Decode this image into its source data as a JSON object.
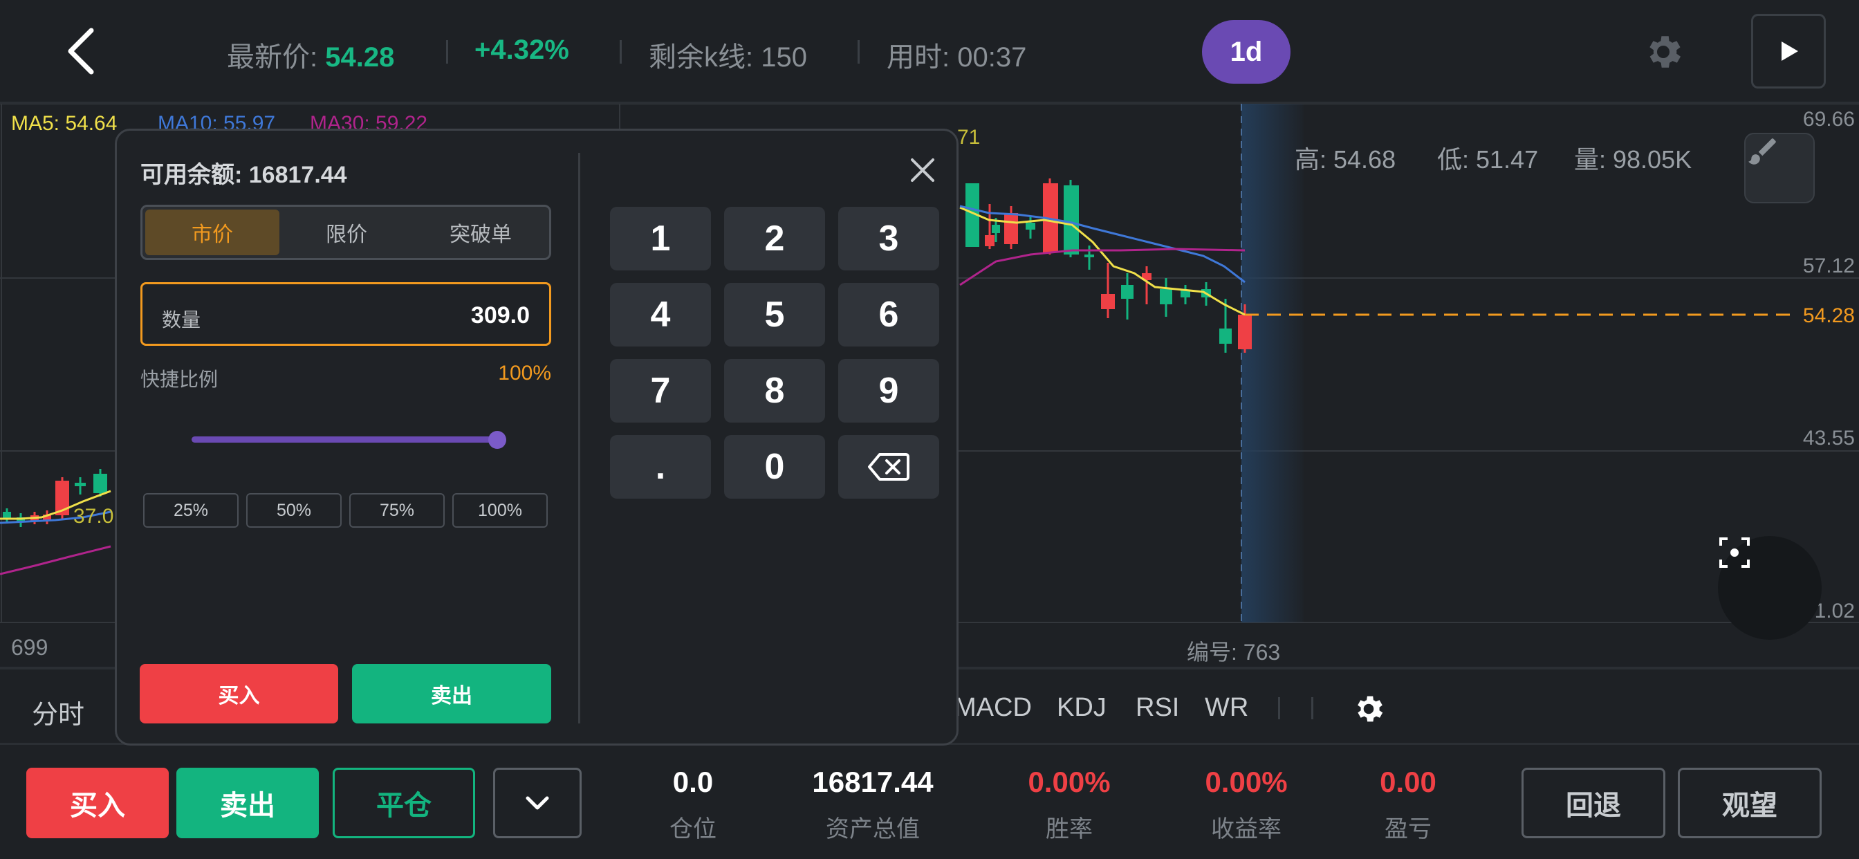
{
  "header": {
    "latest_label": "最新价:",
    "latest_price": "54.28",
    "change_pct": "+4.32%",
    "remaining_label": "剩余k线:",
    "remaining_value": "150",
    "time_label": "用时:",
    "time_value": "00:37",
    "timeframe": "1d",
    "icons": [
      "back-icon",
      "gear-icon",
      "play-icon"
    ]
  },
  "chart": {
    "ma_legend": {
      "ma5": "MA5: 54.64",
      "ma10": "MA10: 55.97",
      "ma30": "MA30: 59.22"
    },
    "y_axis_labels": [
      "69.66",
      "57.12",
      "43.55",
      "31.02"
    ],
    "price_line_label": "54.28",
    "peak_label": "71",
    "low_label": "37.0",
    "high_info": "高: 54.68",
    "low_info": "低: 51.47",
    "volume_info": "量: 98.05K",
    "left_index": "699",
    "index_label": "编号: 763",
    "colors": {
      "up": "#ef4045",
      "down": "#13b47f",
      "ma5": "#f0e04a",
      "ma10": "#3f78d8",
      "ma30": "#b0248c",
      "price_line": "#f29a1f"
    }
  },
  "indicators": {
    "time_share": "分时",
    "items": [
      "MACD",
      "KDJ",
      "RSI",
      "WR"
    ]
  },
  "bottom": {
    "buy": "买入",
    "sell": "卖出",
    "close_position": "平仓",
    "stats": [
      {
        "value": "0.0",
        "label": "仓位",
        "color": "#ffffff"
      },
      {
        "value": "16817.44",
        "label": "资产总值",
        "color": "#ffffff"
      },
      {
        "value": "0.00%",
        "label": "胜率",
        "color": "#ef4045"
      },
      {
        "value": "0.00%",
        "label": "收益率",
        "color": "#ef4045"
      },
      {
        "value": "0.00",
        "label": "盈亏",
        "color": "#ef4045"
      }
    ],
    "rewind": "回退",
    "watch": "观望"
  },
  "modal": {
    "balance": "可用余额: 16817.44",
    "order_types": [
      "市价",
      "限价",
      "突破单"
    ],
    "active_order_type": "市价",
    "quantity_label": "数量",
    "quantity_value": "309.0",
    "ratio_label": "快捷比例",
    "ratio_value": "100%",
    "ratio_fraction": 1.0,
    "presets": [
      "25%",
      "50%",
      "75%",
      "100%"
    ],
    "buy": "买入",
    "sell": "卖出",
    "keypad": [
      "1",
      "2",
      "3",
      "4",
      "5",
      "6",
      "7",
      "8",
      "9",
      ".",
      "0",
      "⌫"
    ]
  }
}
